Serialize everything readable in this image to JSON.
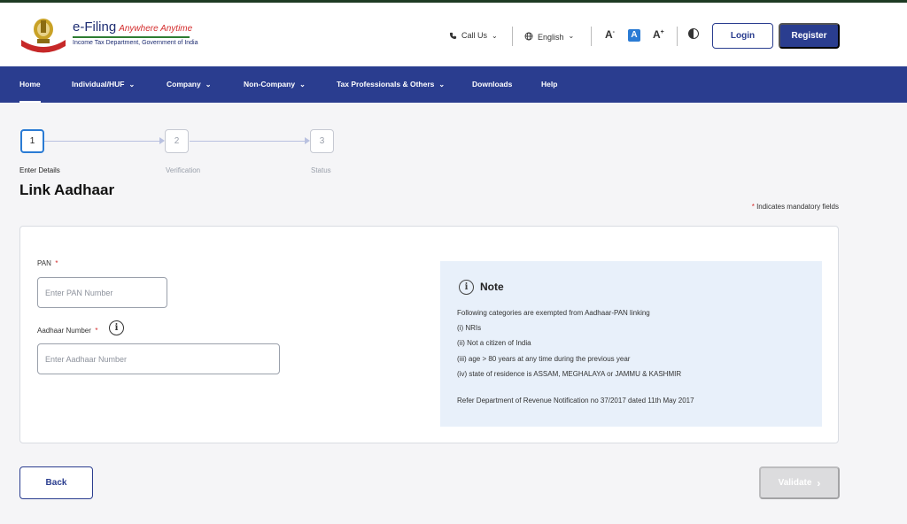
{
  "header": {
    "logo_title": "e-Filing",
    "logo_tagline": "Anywhere Anytime",
    "logo_subtitle": "Income Tax Department, Government of India",
    "call_us": "Call Us",
    "language": "English",
    "font_decrease": "A",
    "font_default": "A",
    "font_increase": "A",
    "login_label": "Login",
    "register_label": "Register"
  },
  "nav": {
    "items": [
      {
        "label": "Home"
      },
      {
        "label": "Individual/HUF"
      },
      {
        "label": "Company"
      },
      {
        "label": "Non-Company"
      },
      {
        "label": "Tax Professionals & Others"
      },
      {
        "label": "Downloads"
      },
      {
        "label": "Help"
      }
    ]
  },
  "stepper": {
    "steps": [
      {
        "number": "1",
        "label": "Enter Details"
      },
      {
        "number": "2",
        "label": "Verification"
      },
      {
        "number": "3",
        "label": "Status"
      }
    ],
    "active_step": 1
  },
  "page": {
    "title": "Link Aadhaar",
    "mandatory_star": "*",
    "mandatory_note": "Indicates mandatory fields"
  },
  "form": {
    "pan_label": "PAN",
    "pan_placeholder": "Enter PAN Number",
    "pan_value": "",
    "aadhaar_label": "Aadhaar Number",
    "aadhaar_placeholder": "Enter Aadhaar Number",
    "aadhaar_value": "",
    "required_mark": "*"
  },
  "note": {
    "title": "Note",
    "intro": "Following categories are exempted from Aadhaar-PAN linking",
    "items": [
      "(i) NRIs",
      "(ii) Not a citizen of India",
      "(iii) age > 80 years at any time during the previous year",
      "(iv) state of residence is ASSAM, MEGHALAYA or JAMMU & KASHMIR"
    ],
    "reference": "Refer Department of Revenue Notification no 37/2017 dated 11th May 2017"
  },
  "actions": {
    "back_label": "Back",
    "validate_label": "Validate",
    "validate_enabled": false
  },
  "colors": {
    "brand_navy": "#2a3d8f",
    "step_active": "#2a7bd4",
    "note_bg": "#e8f0fa",
    "required": "#d32b2b"
  }
}
